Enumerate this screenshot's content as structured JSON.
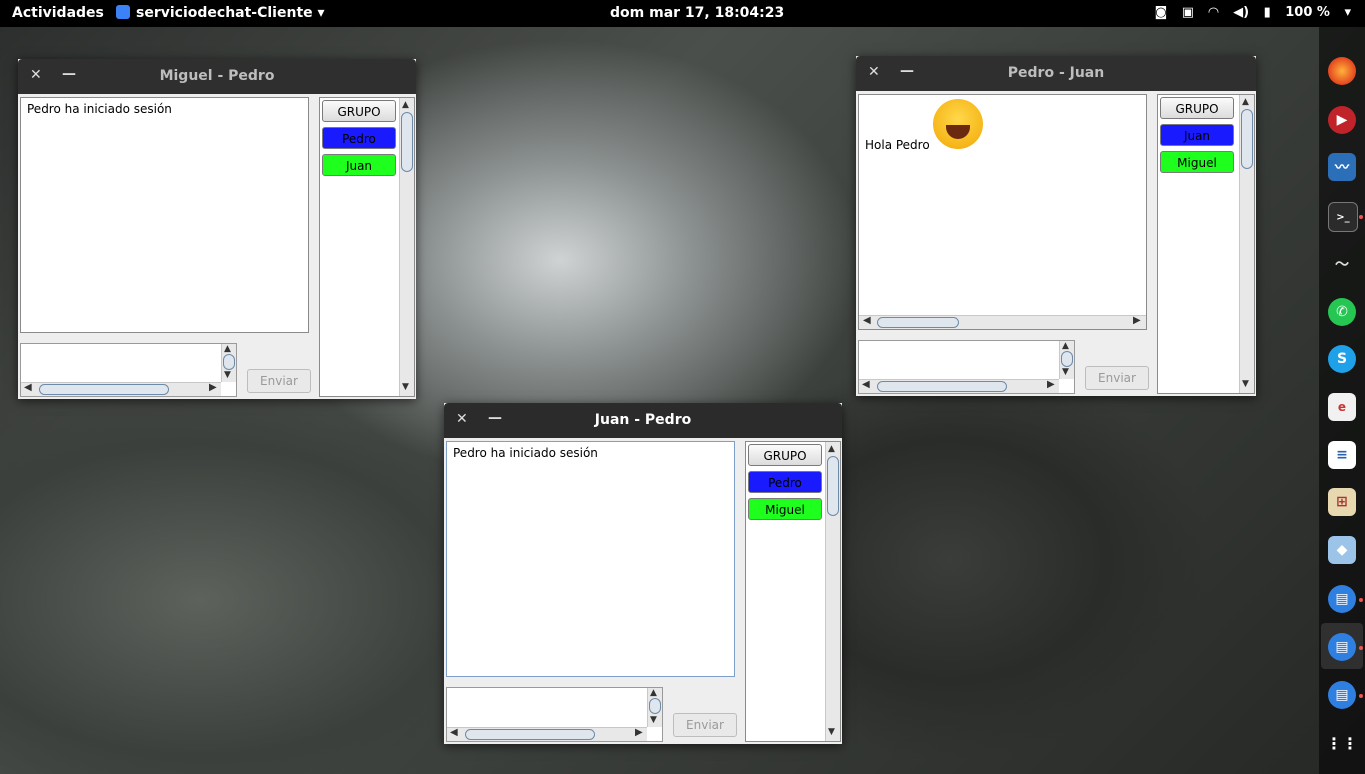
{
  "topbar": {
    "activities": "Actividades",
    "app_name": "serviciodechat-Cliente ▾",
    "clock": "dom mar 17, 18:04:23",
    "battery": "100 %",
    "battery_caret": "▾"
  },
  "windows": {
    "miguel": {
      "title": "Miguel - Pedro",
      "messages": [
        "Pedro ha iniciado sesión"
      ],
      "group_button": "GRUPO",
      "users": [
        "Pedro",
        "Juan"
      ],
      "send_label": "Enviar"
    },
    "pedro": {
      "title": "Pedro - Juan",
      "messages": [
        "Hola Pedro"
      ],
      "emoji": "face-with-tears-of-joy",
      "group_button": "GRUPO",
      "users": [
        "Juan",
        "Miguel"
      ],
      "send_label": "Enviar"
    },
    "juan": {
      "title": "Juan - Pedro",
      "messages": [
        "Pedro ha iniciado sesión"
      ],
      "group_button": "GRUPO",
      "users": [
        "Pedro",
        "Miguel"
      ],
      "send_label": "Enviar"
    }
  },
  "colors": {
    "user_blue": "#1a1aff",
    "user_green": "#1eff1e"
  },
  "dock": {
    "icons": [
      "firefox-icon",
      "media-player-icon",
      "system-monitor-icon",
      "terminal-icon",
      "audio-waveform-icon",
      "whatsapp-icon",
      "skype-icon",
      "document-viewer-icon",
      "text-editor-icon",
      "diagram-icon",
      "virtualbox-icon",
      "chat-client-icon",
      "chat-client-icon",
      "chat-client-icon",
      "app-grid-icon"
    ]
  }
}
